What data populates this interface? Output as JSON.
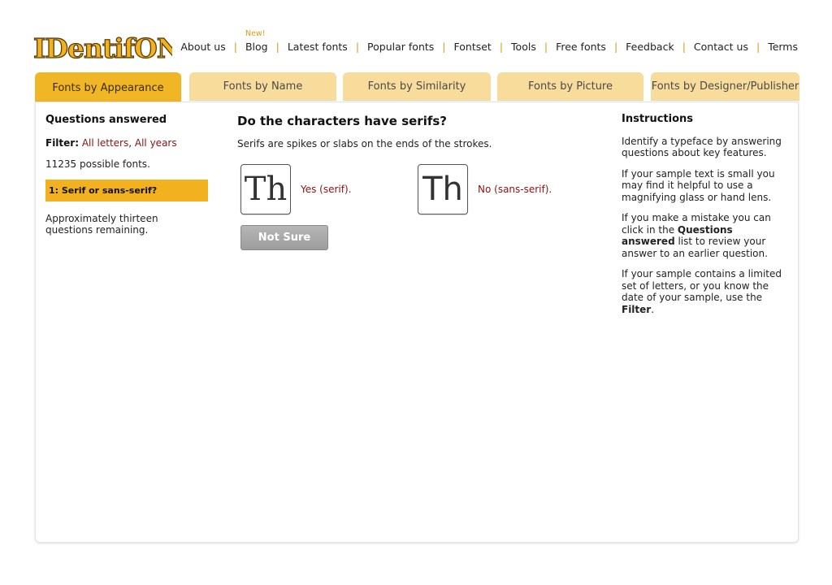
{
  "brand": {
    "logo_text": "IDentifONT"
  },
  "topnav": {
    "badge_new": "New!",
    "items": [
      "About us",
      "Blog",
      "Latest fonts",
      "Popular fonts",
      "Fontset",
      "Tools",
      "Free fonts",
      "Feedback",
      "Contact us",
      "Terms"
    ],
    "separator": "|"
  },
  "tabs": [
    "Fonts by Appearance",
    "Fonts by Name",
    "Fonts by Similarity",
    "Fonts by Picture",
    "Fonts by Designer/Publisher"
  ],
  "left": {
    "heading": "Questions answered",
    "filter_label": "Filter:",
    "filter_letters": "All letters",
    "filter_sep": ",",
    "filter_years": "All years",
    "possible": "11235 possible fonts.",
    "question_item": "1: Serif or sans-serif?",
    "remaining": "Approximately thirteen questions remaining."
  },
  "question": {
    "title": "Do the characters have serifs?",
    "explain": "Serifs are spikes or slabs on the ends of the strokes.",
    "sample_text": "Th",
    "yes_label": "Yes (serif).",
    "no_label": "No (sans-serif).",
    "not_sure": "Not Sure"
  },
  "instructions": {
    "heading": "Instructions",
    "p1": "Identify a typeface by answering questions about key features.",
    "p2": "If your sample text is small you may find it helpful to use a magnifying glass or hand lens.",
    "p3_pre": "If you make a mistake you can click in the ",
    "p3_bold": "Questions answered",
    "p3_post": " list to review your answer to an earlier question.",
    "p4_pre": "If your sample contains a limited set of letters, or you know the date of your sample, use the ",
    "p4_bold": "Filter",
    "p4_post": "."
  },
  "colors": {
    "tab_active": "#f0b626",
    "tab_inactive": "#f8dc9c",
    "accent_link": "#8b1212",
    "logo_fill": "#f1b21e",
    "logo_stroke": "#5a3c08"
  }
}
